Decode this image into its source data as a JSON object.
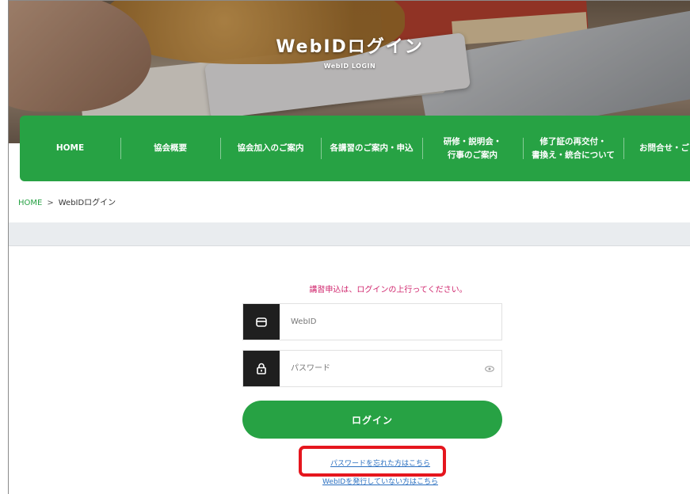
{
  "hero": {
    "title": "WebIDログイン",
    "subtitle": "WebID LOGIN"
  },
  "nav": {
    "items": [
      {
        "label": "HOME"
      },
      {
        "label": "協会概要"
      },
      {
        "label": "協会加入のご案内"
      },
      {
        "label": "各講習のご案内・申込"
      },
      {
        "label_line1": "研修・説明会・",
        "label_line2": "行事のご案内"
      },
      {
        "label_line1": "修了証の再交付・",
        "label_line2": "書換え・統合について"
      },
      {
        "label": "お問合せ・ご"
      }
    ]
  },
  "breadcrumb": {
    "home": "HOME",
    "separator": ">",
    "current": "WebIDログイン"
  },
  "form": {
    "notice": "講習申込は、ログインの上行ってください。",
    "webid_placeholder": "WebID",
    "password_placeholder": "パスワード",
    "login_label": "ログイン",
    "forgot_link": "パスワードを忘れた方はこちら",
    "no_webid_link": "WebIDを発行していない方はこちら"
  },
  "colors": {
    "brand_green": "#27a244",
    "notice_pink": "#d0266d",
    "link_blue": "#2a6fc0",
    "highlight_red": "#e5161e"
  },
  "icons": {
    "webid": "mail-icon",
    "password": "lock-icon",
    "toggle": "eye-icon"
  }
}
